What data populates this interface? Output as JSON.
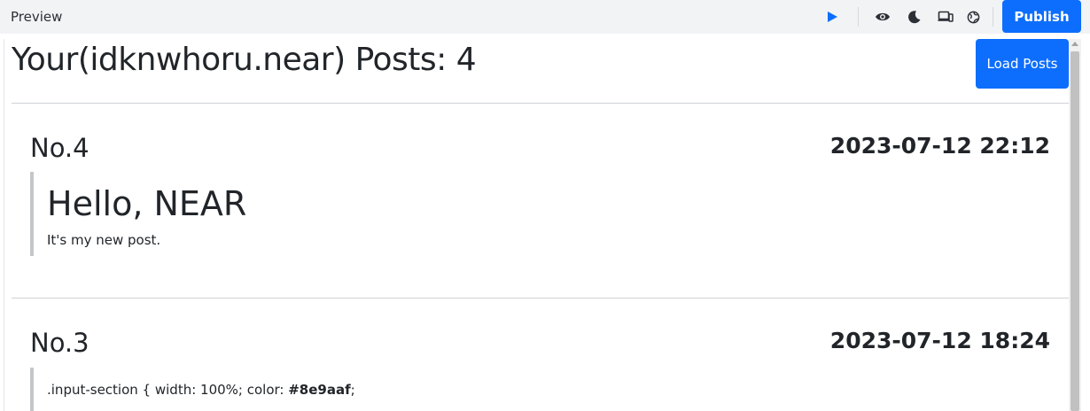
{
  "toolbar": {
    "title": "Preview",
    "publish_label": "Publish",
    "icons": [
      "play-icon",
      "eye-icon",
      "moon-icon",
      "devices-icon",
      "globe-icon"
    ],
    "accent": "#0d6efd"
  },
  "page": {
    "title": "Your(idknwhoru.near) Posts: 4",
    "load_label": "Load Posts"
  },
  "posts": [
    {
      "number": "No.4",
      "date": "2023-07-12 22:12",
      "heading": "Hello, NEAR",
      "body": "It's my new post."
    },
    {
      "number": "No.3",
      "date": "2023-07-12 18:24",
      "code_prefix": ".input-section { width: 100%; color: ",
      "code_bold": "#8e9aaf",
      "code_suffix": ";"
    }
  ]
}
